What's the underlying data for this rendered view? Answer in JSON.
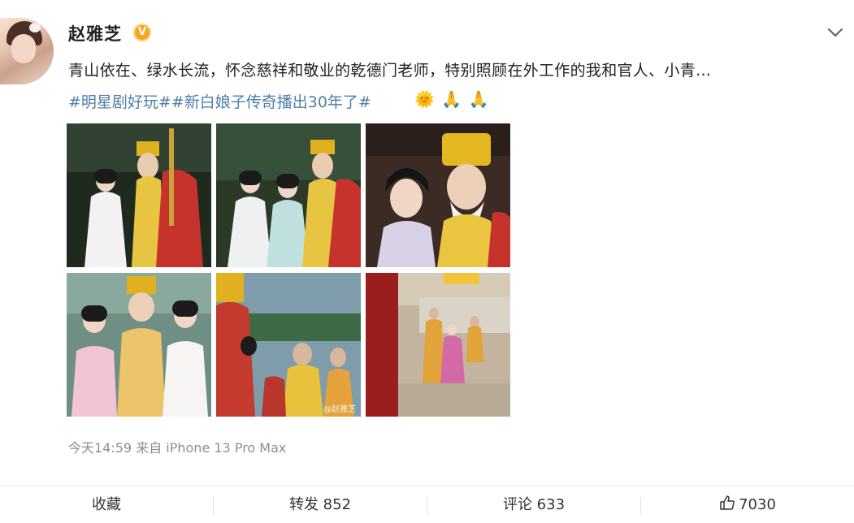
{
  "post": {
    "username": "赵雅芝",
    "verified_mark": "V",
    "text": "青山依在、绿水长流，怀念慈祥和敬业的乾德门老师，特别照顾在外工作的我和官人、小青…",
    "topics": "#明星剧好玩##新白娘子传奇播出30年了#",
    "emojis": [
      "🌞",
      "🙏",
      "🙏"
    ],
    "watermark": "@赵雅芝",
    "meta": "今天14:59  来自 iPhone 13 Pro Max"
  },
  "actions": {
    "favorite_label": "收藏",
    "repost_label": "转发 852",
    "comment_label": "评论 633",
    "like_count": "7030"
  },
  "icons": {
    "verified": "verified-badge-icon",
    "more": "chevron-down-icon",
    "like": "thumbs-up-icon"
  },
  "colors": {
    "topic": "#4f7fa8",
    "verified": "#f5a623",
    "meta": "#8e8e8e"
  }
}
